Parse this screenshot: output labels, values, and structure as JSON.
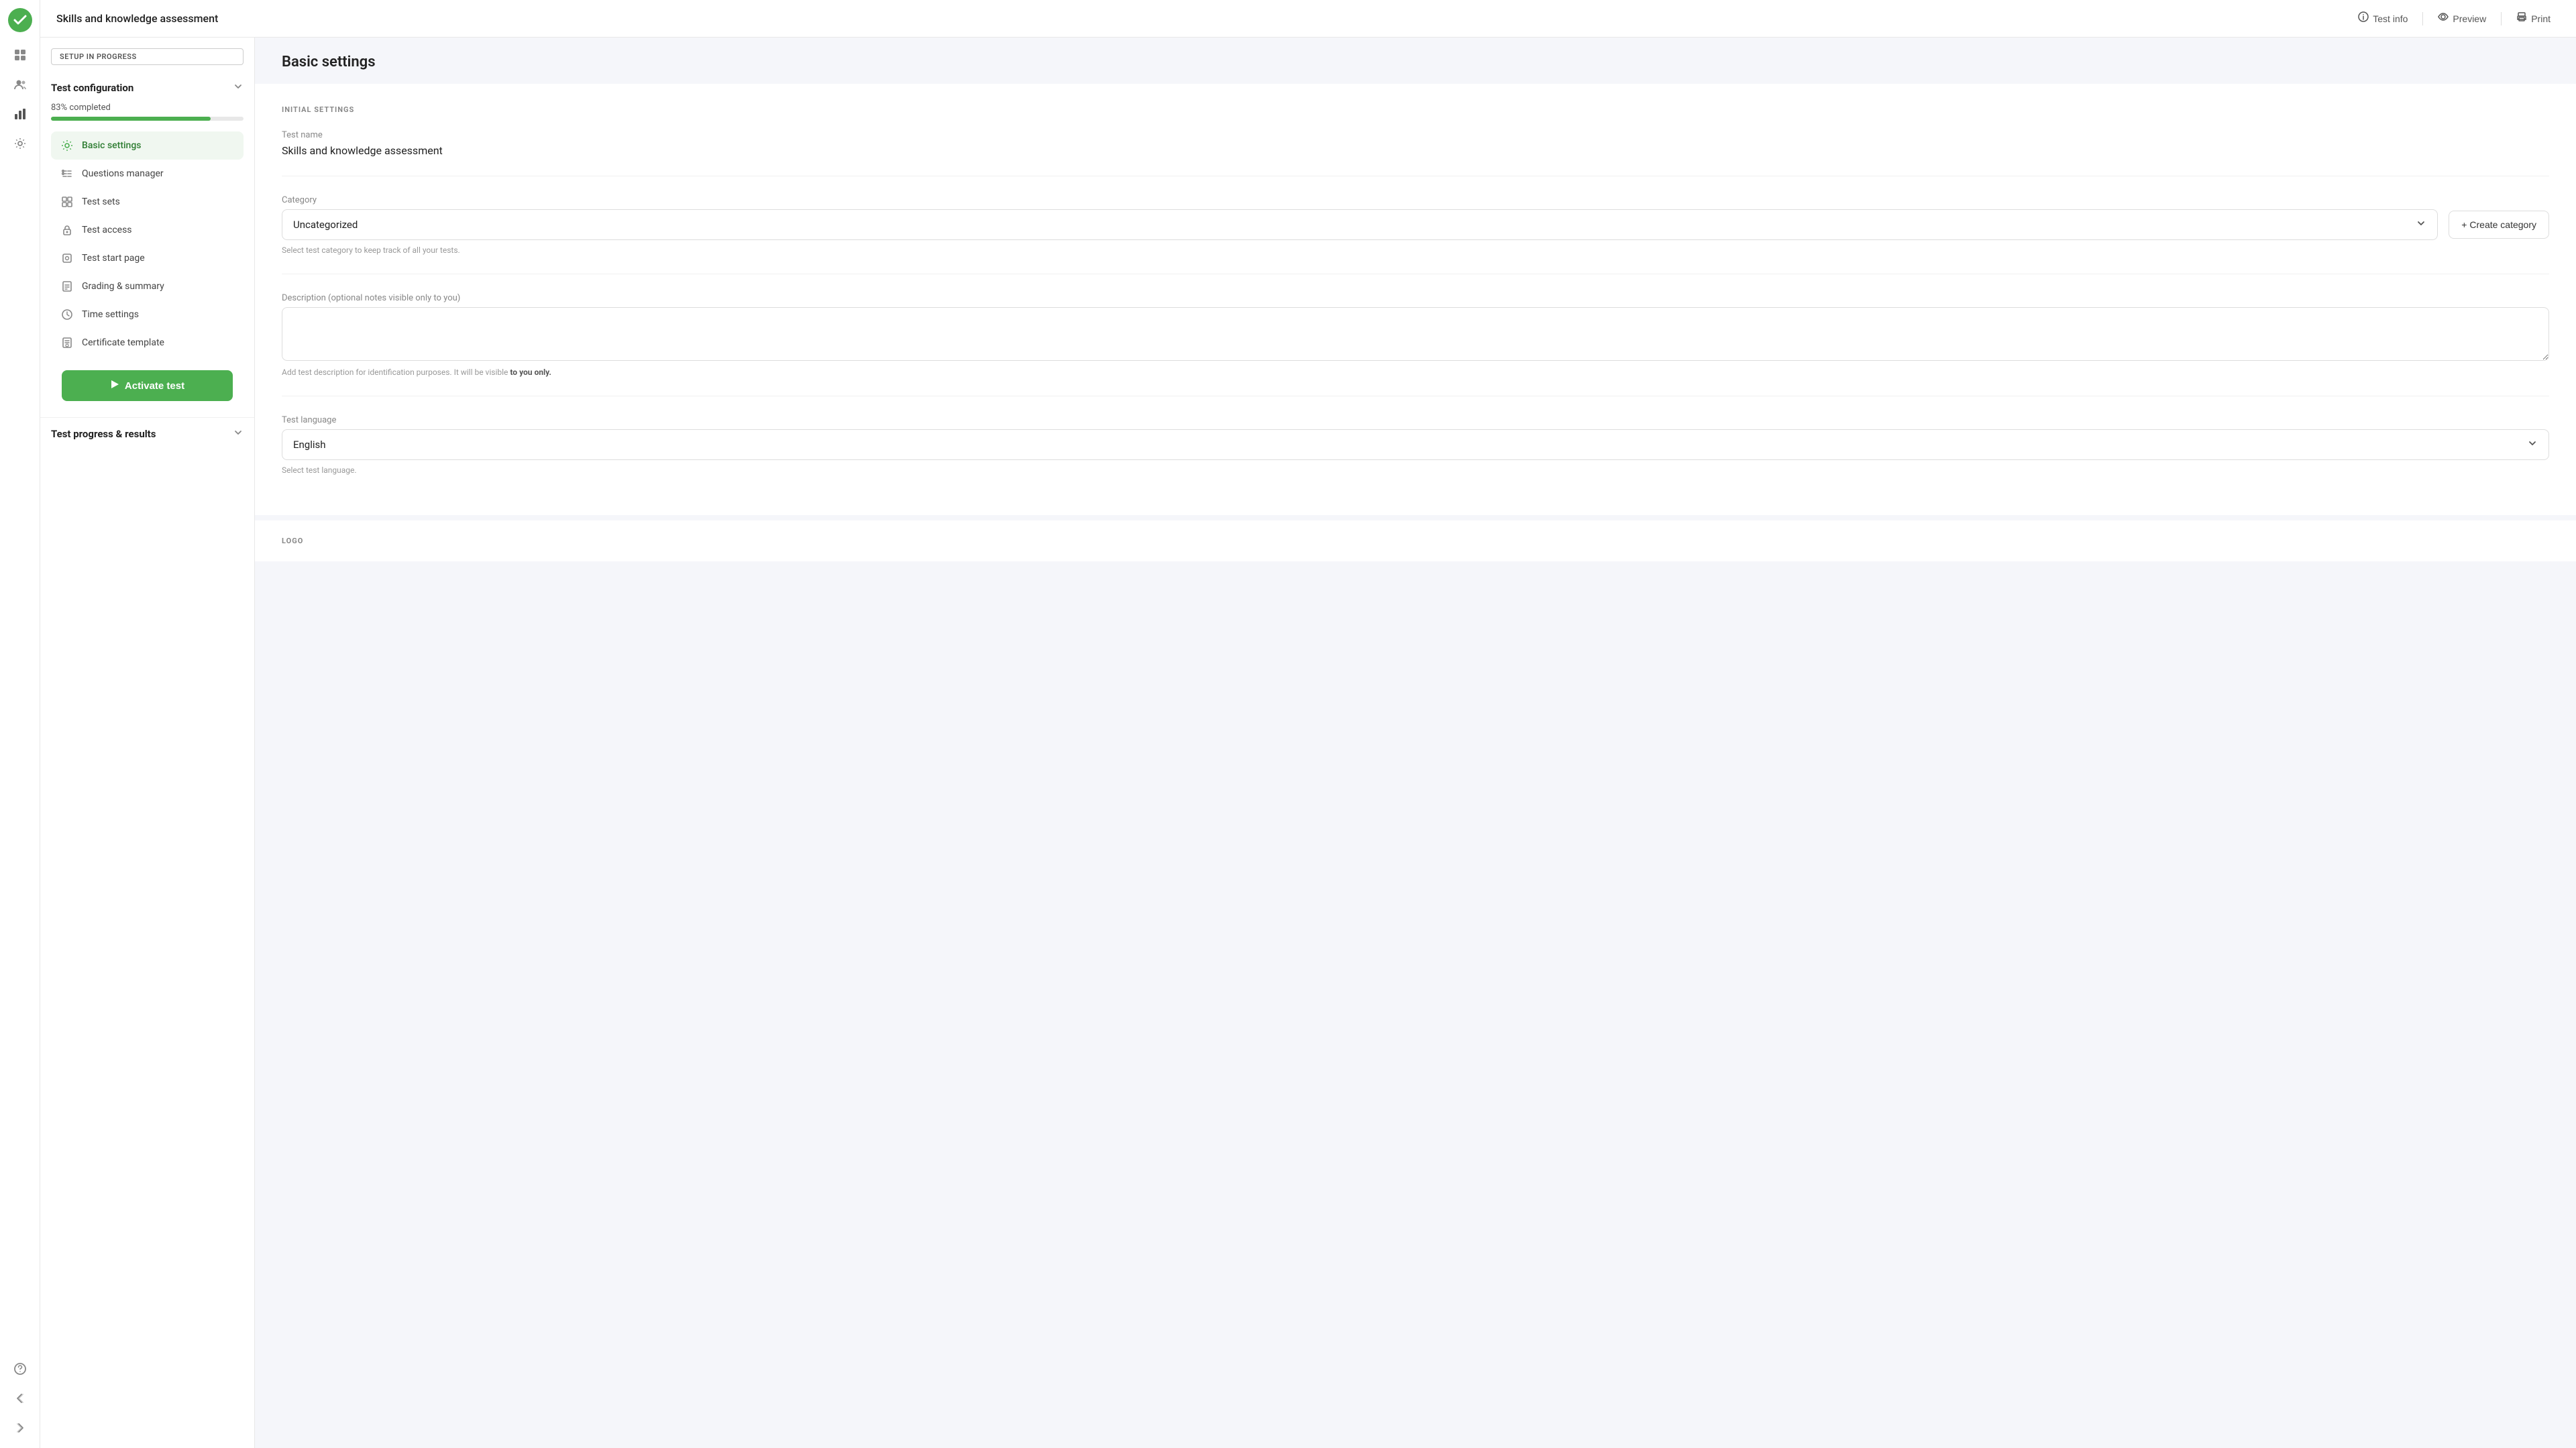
{
  "app": {
    "logo_color": "#4caf50"
  },
  "header": {
    "page_title": "Skills and knowledge assessment",
    "actions": [
      {
        "id": "test-info",
        "label": "Test info",
        "icon": "ℹ"
      },
      {
        "id": "preview",
        "label": "Preview",
        "icon": "👁"
      },
      {
        "id": "print",
        "label": "Print",
        "icon": "🖨"
      }
    ]
  },
  "left_panel": {
    "setup_badge": "SETUP IN PROGRESS",
    "config_section": {
      "title": "Test configuration",
      "progress_label": "83% completed",
      "progress_percent": 83
    },
    "nav_items": [
      {
        "id": "basic-settings",
        "label": "Basic settings",
        "icon": "⚙",
        "active": true
      },
      {
        "id": "questions-manager",
        "label": "Questions manager",
        "icon": "≡",
        "active": false
      },
      {
        "id": "test-sets",
        "label": "Test sets",
        "icon": "⊞",
        "active": false
      },
      {
        "id": "test-access",
        "label": "Test access",
        "icon": "🔒",
        "active": false
      },
      {
        "id": "test-start-page",
        "label": "Test start page",
        "icon": "◻",
        "active": false
      },
      {
        "id": "grading-summary",
        "label": "Grading & summary",
        "icon": "📋",
        "active": false
      },
      {
        "id": "time-settings",
        "label": "Time settings",
        "icon": "🕐",
        "active": false
      },
      {
        "id": "certificate-template",
        "label": "Certificate template",
        "icon": "📄",
        "active": false
      }
    ],
    "activate_button": "Activate test",
    "test_progress": {
      "title": "Test progress & results"
    }
  },
  "main": {
    "section_title": "Basic settings",
    "initial_settings_label": "INITIAL SETTINGS",
    "test_name_label": "Test name",
    "test_name_value": "Skills and knowledge assessment",
    "category_label": "Category",
    "category_value": "Uncategorized",
    "category_helper": "Select test category to keep track of all your tests.",
    "create_category_label": "+ Create category",
    "description_label": "Description (optional notes visible only to you)",
    "description_helper_1": "Add test description for identification purposes. It will be visible",
    "description_helper_bold": "to you only.",
    "test_language_label": "Test language",
    "test_language_value": "English",
    "test_language_helper": "Select test language.",
    "logo_label": "LOGO"
  },
  "icon_sidebar": {
    "nav_icons": [
      {
        "id": "home",
        "icon": "✓",
        "is_logo": true
      },
      {
        "id": "apps",
        "icon": "⊞"
      },
      {
        "id": "users",
        "icon": "👥"
      },
      {
        "id": "chart",
        "icon": "📊"
      },
      {
        "id": "settings",
        "icon": "⚙"
      }
    ],
    "bottom_icons": [
      {
        "id": "help",
        "icon": "?"
      },
      {
        "id": "back",
        "icon": "←"
      },
      {
        "id": "expand",
        "icon": ">>"
      }
    ]
  }
}
